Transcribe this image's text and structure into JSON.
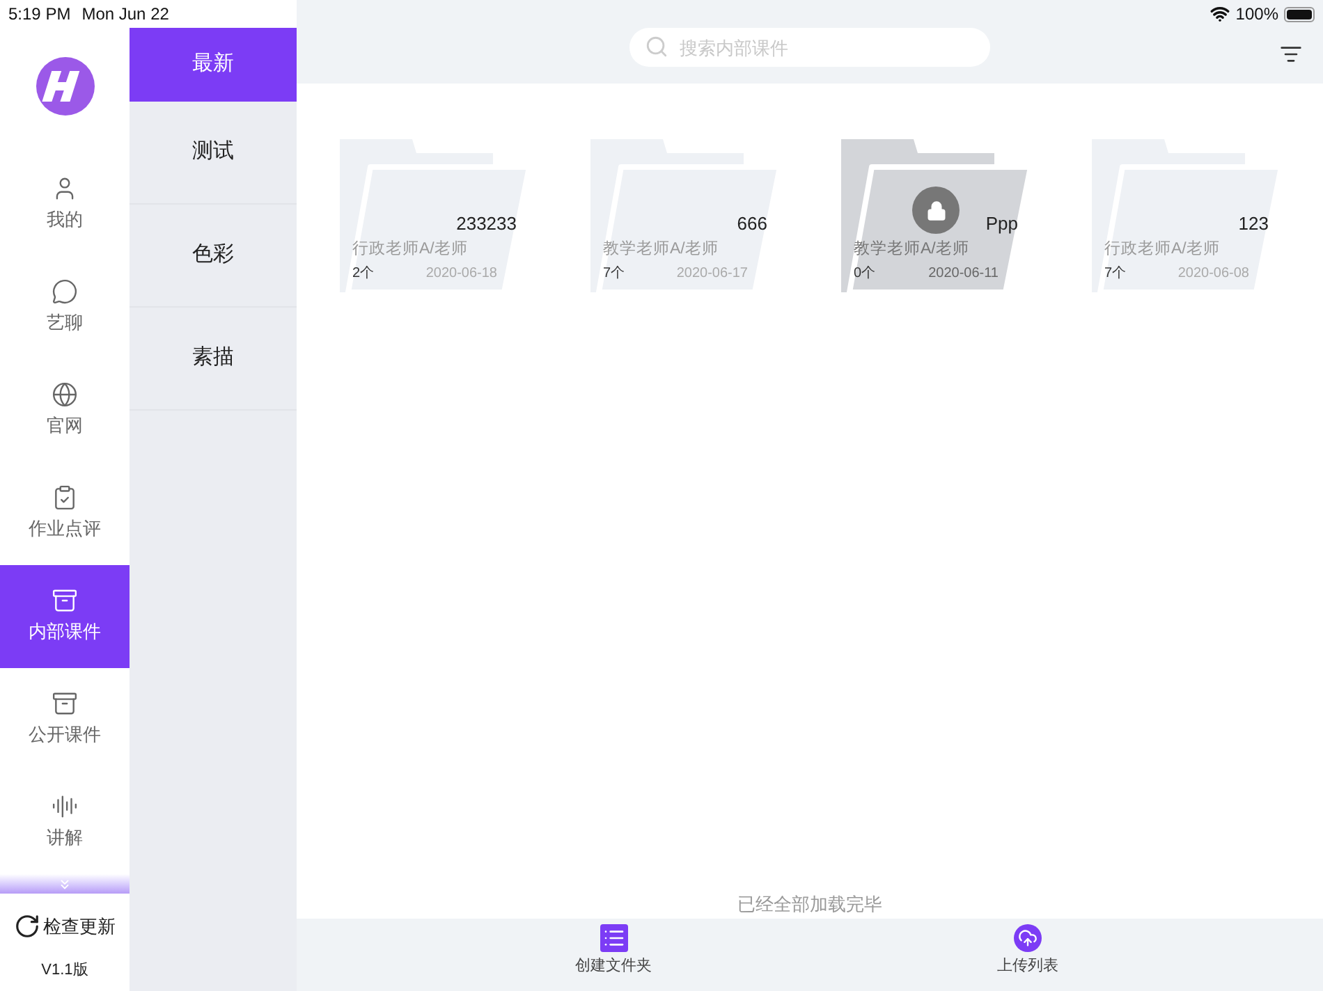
{
  "status_bar": {
    "time": "5:19 PM",
    "date": "Mon Jun 22",
    "battery": "100%"
  },
  "nav": {
    "items": [
      {
        "label": "我的",
        "selected": false
      },
      {
        "label": "艺聊",
        "selected": false
      },
      {
        "label": "官网",
        "selected": false
      },
      {
        "label": "作业点评",
        "selected": false
      },
      {
        "label": "内部课件",
        "selected": true
      },
      {
        "label": "公开课件",
        "selected": false
      },
      {
        "label": "讲解",
        "selected": false
      }
    ],
    "check_update": "检查更新",
    "version": "V1.1版"
  },
  "categories": [
    {
      "label": "最新",
      "selected": true
    },
    {
      "label": "测试",
      "selected": false
    },
    {
      "label": "色彩",
      "selected": false
    },
    {
      "label": "素描",
      "selected": false
    }
  ],
  "search": {
    "placeholder": "搜索内部课件"
  },
  "folders": [
    {
      "name": "233233",
      "owner": "行政老师A/老师",
      "count": "2个",
      "date": "2020-06-18",
      "locked": false
    },
    {
      "name": "666",
      "owner": "教学老师A/老师",
      "count": "7个",
      "date": "2020-06-17",
      "locked": false
    },
    {
      "name": "Ppp",
      "owner": "教学老师A/老师",
      "count": "0个",
      "date": "2020-06-11",
      "locked": true
    },
    {
      "name": "123",
      "owner": "行政老师A/老师",
      "count": "7个",
      "date": "2020-06-08",
      "locked": false
    }
  ],
  "end_message": "已经全部加载完毕",
  "footer": {
    "create_folder": "创建文件夹",
    "upload_list": "上传列表"
  }
}
